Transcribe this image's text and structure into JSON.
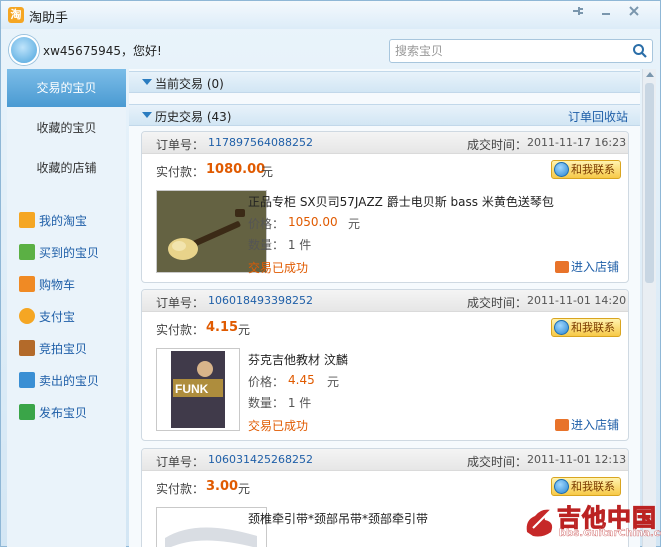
{
  "window": {
    "title": "淘助手",
    "logo_char": "淘"
  },
  "header": {
    "greeting": "xw45675945，您好!",
    "search_placeholder": "搜索宝贝"
  },
  "sidebar": {
    "tabs": [
      {
        "label": "交易的宝贝",
        "active": true
      },
      {
        "label": "收藏的宝贝",
        "active": false
      },
      {
        "label": "收藏的店铺",
        "active": false
      }
    ],
    "links": [
      {
        "label": "我的淘宝",
        "icon": "taobao-icon",
        "color": "#f5a623"
      },
      {
        "label": "买到的宝贝",
        "icon": "gift-icon",
        "color": "#5bb044"
      },
      {
        "label": "购物车",
        "icon": "cart-icon",
        "color": "#f08a24"
      },
      {
        "label": "支付宝",
        "icon": "alipay-icon",
        "color": "#f5a623"
      },
      {
        "label": "竞拍宝贝",
        "icon": "auction-hammer-icon",
        "color": "#b36a2a"
      },
      {
        "label": "卖出的宝贝",
        "icon": "gift-icon",
        "color": "#3a8fd4"
      },
      {
        "label": "发布宝贝",
        "icon": "publish-arrow-icon",
        "color": "#3aa548"
      }
    ]
  },
  "sections": {
    "current": {
      "title": "当前交易 (0)"
    },
    "history": {
      "title": "历史交易 (43)",
      "link": "订单回收站"
    }
  },
  "labels": {
    "order_no": "订单号：",
    "deal_time": "成交时间：",
    "paid": "实付款：",
    "currency": "元",
    "price": "价格：",
    "contact": "和我联系",
    "enter_store": "进入店铺"
  },
  "orders": [
    {
      "order_no": "117897564088252",
      "deal_time": "2011-11-17 16:23",
      "paid": "1080.00",
      "title": "正品专柜 SX贝司57JAZZ 爵士电贝斯 bass 米黄色送琴包",
      "price": "1050.00",
      "qty": "数量： 1 件",
      "status": "交易已成功"
    },
    {
      "order_no": "106018493398252",
      "deal_time": "2011-11-01 14:20",
      "paid": "4.15",
      "title": "芬克吉他教材 汶麟",
      "price": "4.45",
      "qty": "数量： 1 件",
      "status": "交易已成功",
      "cover_text": "FUNK"
    },
    {
      "order_no": "106031425268252",
      "deal_time": "2011-11-01 12:13",
      "paid": "3.00",
      "title": "颈椎牵引带*颈部吊带*颈部牵引带"
    }
  ],
  "watermark": {
    "text_cn": "吉他中国",
    "url": "bbs.GuitarChina.com"
  },
  "colors": {
    "accent": "#4a9ad2",
    "link": "#1f5fa8",
    "price": "#e05a00"
  }
}
